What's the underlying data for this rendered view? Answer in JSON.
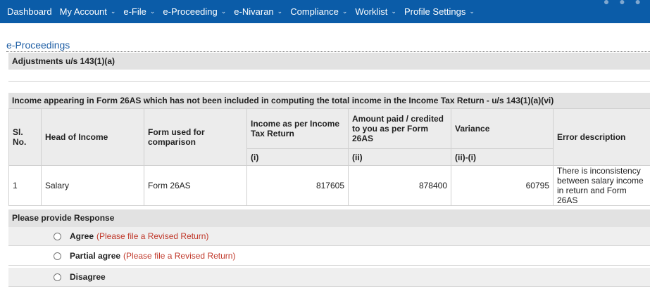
{
  "nav": {
    "items": [
      {
        "label": "Dashboard",
        "dropdown": false
      },
      {
        "label": "My Account",
        "dropdown": true
      },
      {
        "label": "e-File",
        "dropdown": true
      },
      {
        "label": "e-Proceeding",
        "dropdown": true
      },
      {
        "label": "e-Nivaran",
        "dropdown": true
      },
      {
        "label": "Compliance",
        "dropdown": true
      },
      {
        "label": "Worklist",
        "dropdown": true
      },
      {
        "label": "Profile Settings",
        "dropdown": true
      }
    ],
    "caret_glyph": "⌄"
  },
  "page": {
    "title": "e-Proceedings",
    "section_title": "Adjustments u/s 143(1)(a)"
  },
  "income_section": {
    "title": "Income appearing in Form 26AS which has not been included in computing the total income in the Income Tax Return - u/s 143(1)(a)(vi)",
    "columns": {
      "sl_no": "Sl. No.",
      "head_of_income": "Head of Income",
      "form_used": "Form used for comparison",
      "income_return": "Income as per Income Tax Return",
      "amount_26as": "Amount paid / credited to you as per Form 26AS",
      "variance": "Variance",
      "error_desc": "Error description"
    },
    "sub_columns": {
      "income_return": "(i)",
      "amount_26as": "(ii)",
      "variance": "(ii)-(i)"
    },
    "rows": [
      {
        "sl_no": "1",
        "head_of_income": "Salary",
        "form_used": "Form 26AS",
        "income_return": "817605",
        "amount_26as": "878400",
        "variance": "60795",
        "error_desc": "There is inconsistency between salary income in return and Form 26AS"
      }
    ]
  },
  "response": {
    "title": "Please provide Response",
    "options": [
      {
        "label": "Agree",
        "note": "(Please file a Revised Return)"
      },
      {
        "label": "Partial agree",
        "note": "(Please file a Revised Return)"
      },
      {
        "label": "Disagree",
        "note": ""
      }
    ]
  },
  "colors": {
    "nav_bg": "#0b5ca8",
    "title_blue": "#1f5fa5",
    "note_red": "#c0392b",
    "section_bg": "#e2e2e2"
  }
}
